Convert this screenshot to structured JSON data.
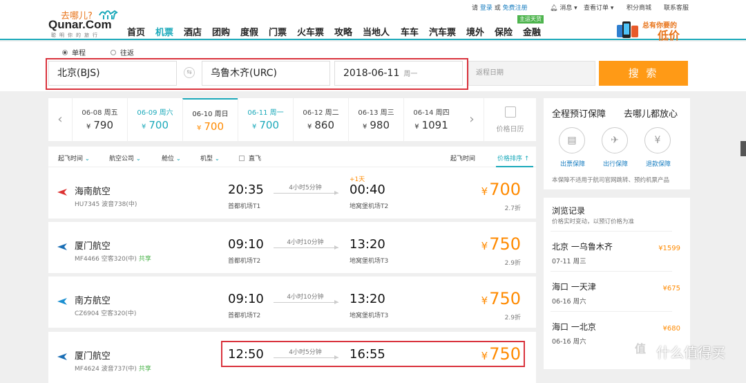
{
  "logo": {
    "cn": "去哪儿?",
    "en": "Qunar.Com",
    "slogan": "聪明你的旅行"
  },
  "nav": {
    "items": [
      "首页",
      "机票",
      "酒店",
      "团购",
      "度假",
      "门票",
      "火车票",
      "攻略",
      "当地人",
      "车车",
      "汽车票",
      "境外",
      "保险",
      "金融"
    ],
    "active_index": 1,
    "badge": "主运天货"
  },
  "toplinks": {
    "greeting": "请",
    "login": "登录",
    "or": "或",
    "register": "免费注册",
    "messages": "消息 ▾",
    "orders": "查看订单 ▾",
    "points": "积分商城",
    "service": "联系客服"
  },
  "promo": {
    "line1": "总有你要的",
    "line2": "低价"
  },
  "search": {
    "trip_oneway": "单程",
    "trip_round": "往返",
    "from": "北京(BJS)",
    "swap_icon": "⇆",
    "to": "乌鲁木齐(URC)",
    "date": "2018-06-11",
    "weekday": "周一",
    "return_placeholder": "返程日期",
    "button": "搜 索"
  },
  "dates": [
    {
      "date": "06-08 周五",
      "price": "790",
      "state": "normal"
    },
    {
      "date": "06-09 周六",
      "price": "700",
      "state": "low"
    },
    {
      "date": "06-10 周日",
      "price": "700",
      "state": "selected"
    },
    {
      "date": "06-11 周一",
      "price": "700",
      "state": "low"
    },
    {
      "date": "06-12 周二",
      "price": "860",
      "state": "normal"
    },
    {
      "date": "06-13 周三",
      "price": "980",
      "state": "normal"
    },
    {
      "date": "06-14 周四",
      "price": "1091",
      "state": "normal"
    }
  ],
  "currency": "¥",
  "calendar_label": "价格日历",
  "filters": {
    "dep_time": "起飞时间",
    "airline": "航空公司",
    "cabin": "舱位",
    "aircraft": "机型",
    "direct": "直飞",
    "sort_time": "起飞时间",
    "sort_price": "价格排序 ↑"
  },
  "flights": [
    {
      "airline": "海南航空",
      "flight_no": "HU7345",
      "aircraft": "波音738(中)",
      "share": "",
      "dep_time": "20:35",
      "dep_airport": "首都机场T1",
      "duration": "4小时5分钟",
      "arr_time": "00:40",
      "arr_airport": "地窝堡机场T2",
      "next_day": "+1天",
      "price": "700",
      "discount": "2.7折",
      "color": "#d33"
    },
    {
      "airline": "厦门航空",
      "flight_no": "MF4466",
      "aircraft": "空客320(中)",
      "share": "共享",
      "dep_time": "09:10",
      "dep_airport": "首都机场T2",
      "duration": "4小时10分钟",
      "arr_time": "13:20",
      "arr_airport": "地窝堡机场T3",
      "next_day": "",
      "price": "750",
      "discount": "2.9折",
      "color": "#1b6fb5"
    },
    {
      "airline": "南方航空",
      "flight_no": "CZ6904",
      "aircraft": "空客320(中)",
      "share": "",
      "dep_time": "09:10",
      "dep_airport": "首都机场T2",
      "duration": "4小时10分钟",
      "arr_time": "13:20",
      "arr_airport": "地窝堡机场T3",
      "next_day": "",
      "price": "750",
      "discount": "2.9折",
      "color": "#1b8fd1"
    },
    {
      "airline": "厦门航空",
      "flight_no": "MF4624",
      "aircraft": "波音737(中)",
      "share": "共享",
      "dep_time": "12:50",
      "dep_airport": "",
      "duration": "4小时5分钟",
      "arr_time": "16:55",
      "arr_airport": "",
      "next_day": "",
      "price": "750",
      "discount": "",
      "color": "#1b6fb5"
    }
  ],
  "guarantee": {
    "title_left": "全程预订保障",
    "title_right": "去哪儿都放心",
    "items": [
      {
        "label": "出票保障",
        "icon": "ticket-icon",
        "glyph": "▤"
      },
      {
        "label": "出行保障",
        "icon": "plane-icon",
        "glyph": "✈"
      },
      {
        "label": "退款保障",
        "icon": "yen-icon",
        "glyph": "¥"
      }
    ],
    "note": "本保障不适用于航司官网跳转、预约机票产品"
  },
  "history": {
    "title": "浏览记录",
    "subtitle": "价格实时变动，以预订价格为准",
    "items": [
      {
        "route": "北京 一乌鲁木齐",
        "date": "07-11 周三",
        "price": "¥1599"
      },
      {
        "route": "海口 一天津",
        "date": "06-16 周六",
        "price": "¥675"
      },
      {
        "route": "海口 一北京",
        "date": "06-16 周六",
        "price": "¥680"
      }
    ]
  },
  "watermark": {
    "text": "什么值得买",
    "glyph": "值"
  }
}
